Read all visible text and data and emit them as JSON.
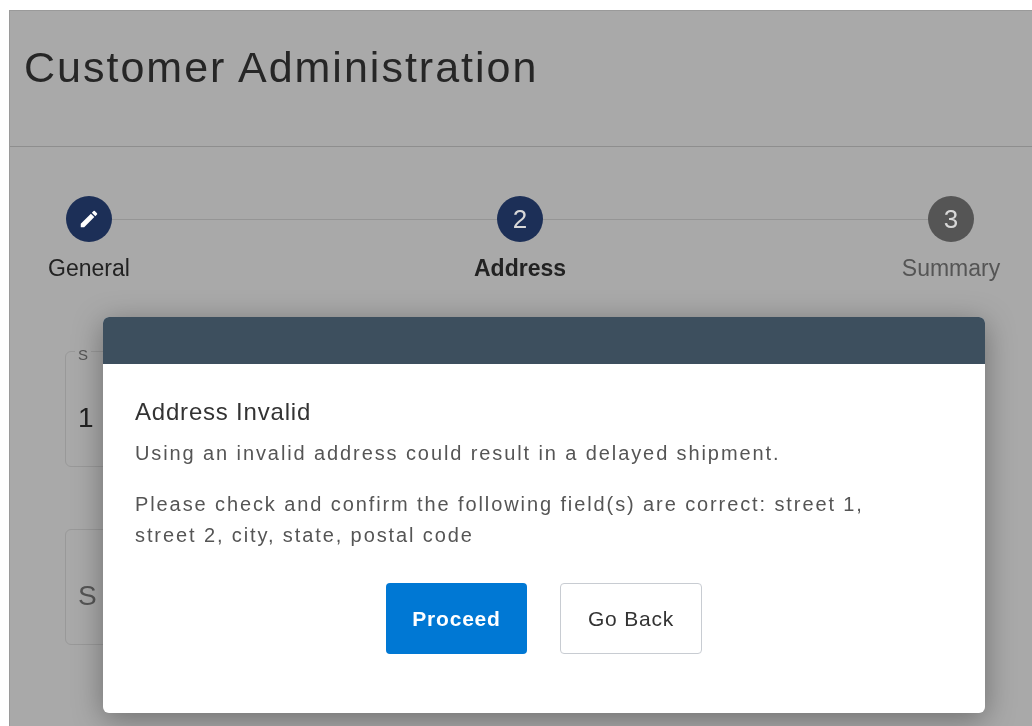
{
  "page": {
    "title": "Customer Administration"
  },
  "stepper": [
    {
      "label": "General",
      "completed": true,
      "selected": false
    },
    {
      "label": "Address",
      "completed": false,
      "selected": true,
      "number": "2"
    },
    {
      "label": "Summary",
      "completed": false,
      "selected": false,
      "number": "3"
    }
  ],
  "fields": [
    {
      "label": "S",
      "value": "1"
    },
    {
      "placeholder": "S"
    }
  ],
  "dialog": {
    "title": "Address Invalid",
    "paragraphs": [
      "Using an invalid address could result in a delayed shipment.",
      "Please check and confirm the following field(s) are correct: street 1, street 2, city, state, postal code"
    ],
    "buttons": [
      {
        "label": "Proceed",
        "kind": "primary"
      },
      {
        "label": "Go Back",
        "kind": "secondary"
      }
    ]
  }
}
